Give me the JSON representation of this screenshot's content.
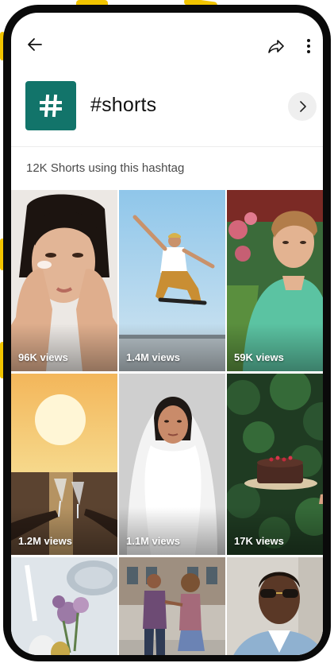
{
  "hashtag": {
    "title": "#shorts",
    "tile_color": "#12746a",
    "tile_icon": "hash-icon"
  },
  "summary": {
    "count_text": "12K Shorts using this hashtag"
  },
  "toolbar": {
    "back_icon": "arrow-left-icon",
    "share_icon": "share-icon",
    "more_icon": "more-vertical-icon",
    "open_icon": "chevron-right-icon"
  },
  "shorts": [
    {
      "views": "96K views",
      "subject": "woman-hands-on-face"
    },
    {
      "views": "1.4M views",
      "subject": "skateboarder-jump"
    },
    {
      "views": "59K views",
      "subject": "young-man-green-jacket"
    },
    {
      "views": "1.2M views",
      "subject": "sunset-toast"
    },
    {
      "views": "1.1M views",
      "subject": "woman-white-blanket"
    },
    {
      "views": "17K views",
      "subject": "chocolate-cake"
    },
    {
      "views": "",
      "subject": "table-flowers"
    },
    {
      "views": "",
      "subject": "dancing-couple"
    },
    {
      "views": "",
      "subject": "man-sunglasses"
    }
  ],
  "colors": {
    "accent": "#12746a",
    "doodle": "#f2c500"
  }
}
